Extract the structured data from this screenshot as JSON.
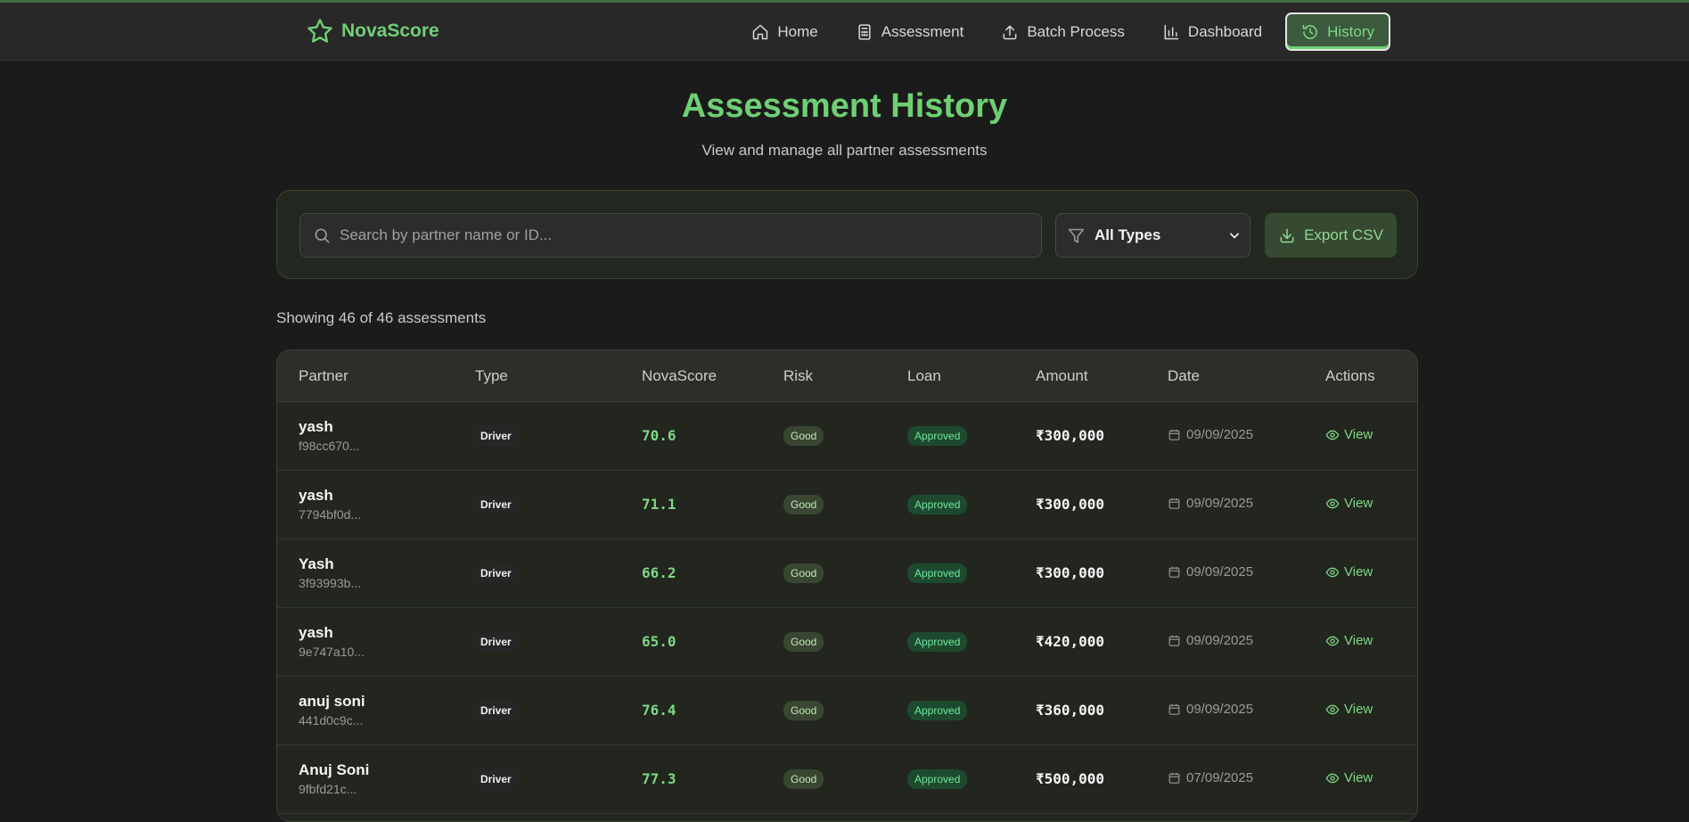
{
  "brand": {
    "name": "NovaScore"
  },
  "nav": [
    {
      "label": "Home",
      "icon": "home-icon",
      "active": false
    },
    {
      "label": "Assessment",
      "icon": "calculator-icon",
      "active": false
    },
    {
      "label": "Batch Process",
      "icon": "upload-icon",
      "active": false
    },
    {
      "label": "Dashboard",
      "icon": "bar-chart-icon",
      "active": false
    },
    {
      "label": "History",
      "icon": "history-icon",
      "active": true
    }
  ],
  "page": {
    "title": "Assessment History",
    "subtitle": "View and manage all partner assessments"
  },
  "toolbar": {
    "search_placeholder": "Search by partner name or ID...",
    "filter_value": "All Types",
    "export_label": "Export CSV"
  },
  "count_text": "Showing 46 of 46 assessments",
  "table": {
    "headers": [
      "Partner",
      "Type",
      "NovaScore",
      "Risk",
      "Loan",
      "Amount",
      "Date",
      "Actions"
    ],
    "rows": [
      {
        "name": "yash",
        "id": "f98cc670...",
        "type": "Driver",
        "score": "70.6",
        "risk": "Good",
        "loan": "Approved",
        "amount": "₹300,000",
        "date": "09/09/2025",
        "action": "View"
      },
      {
        "name": "yash",
        "id": "7794bf0d...",
        "type": "Driver",
        "score": "71.1",
        "risk": "Good",
        "loan": "Approved",
        "amount": "₹300,000",
        "date": "09/09/2025",
        "action": "View"
      },
      {
        "name": "Yash",
        "id": "3f93993b...",
        "type": "Driver",
        "score": "66.2",
        "risk": "Good",
        "loan": "Approved",
        "amount": "₹300,000",
        "date": "09/09/2025",
        "action": "View"
      },
      {
        "name": "yash",
        "id": "9e747a10...",
        "type": "Driver",
        "score": "65.0",
        "risk": "Good",
        "loan": "Approved",
        "amount": "₹420,000",
        "date": "09/09/2025",
        "action": "View"
      },
      {
        "name": "anuj soni",
        "id": "441d0c9c...",
        "type": "Driver",
        "score": "76.4",
        "risk": "Good",
        "loan": "Approved",
        "amount": "₹360,000",
        "date": "09/09/2025",
        "action": "View"
      },
      {
        "name": "Anuj Soni",
        "id": "9fbfd21c...",
        "type": "Driver",
        "score": "77.3",
        "risk": "Good",
        "loan": "Approved",
        "amount": "₹500,000",
        "date": "07/09/2025",
        "action": "View"
      }
    ]
  },
  "colors": {
    "accent": "#6fcf74",
    "background": "#1b1b1b",
    "approved": "#6ee79d"
  }
}
